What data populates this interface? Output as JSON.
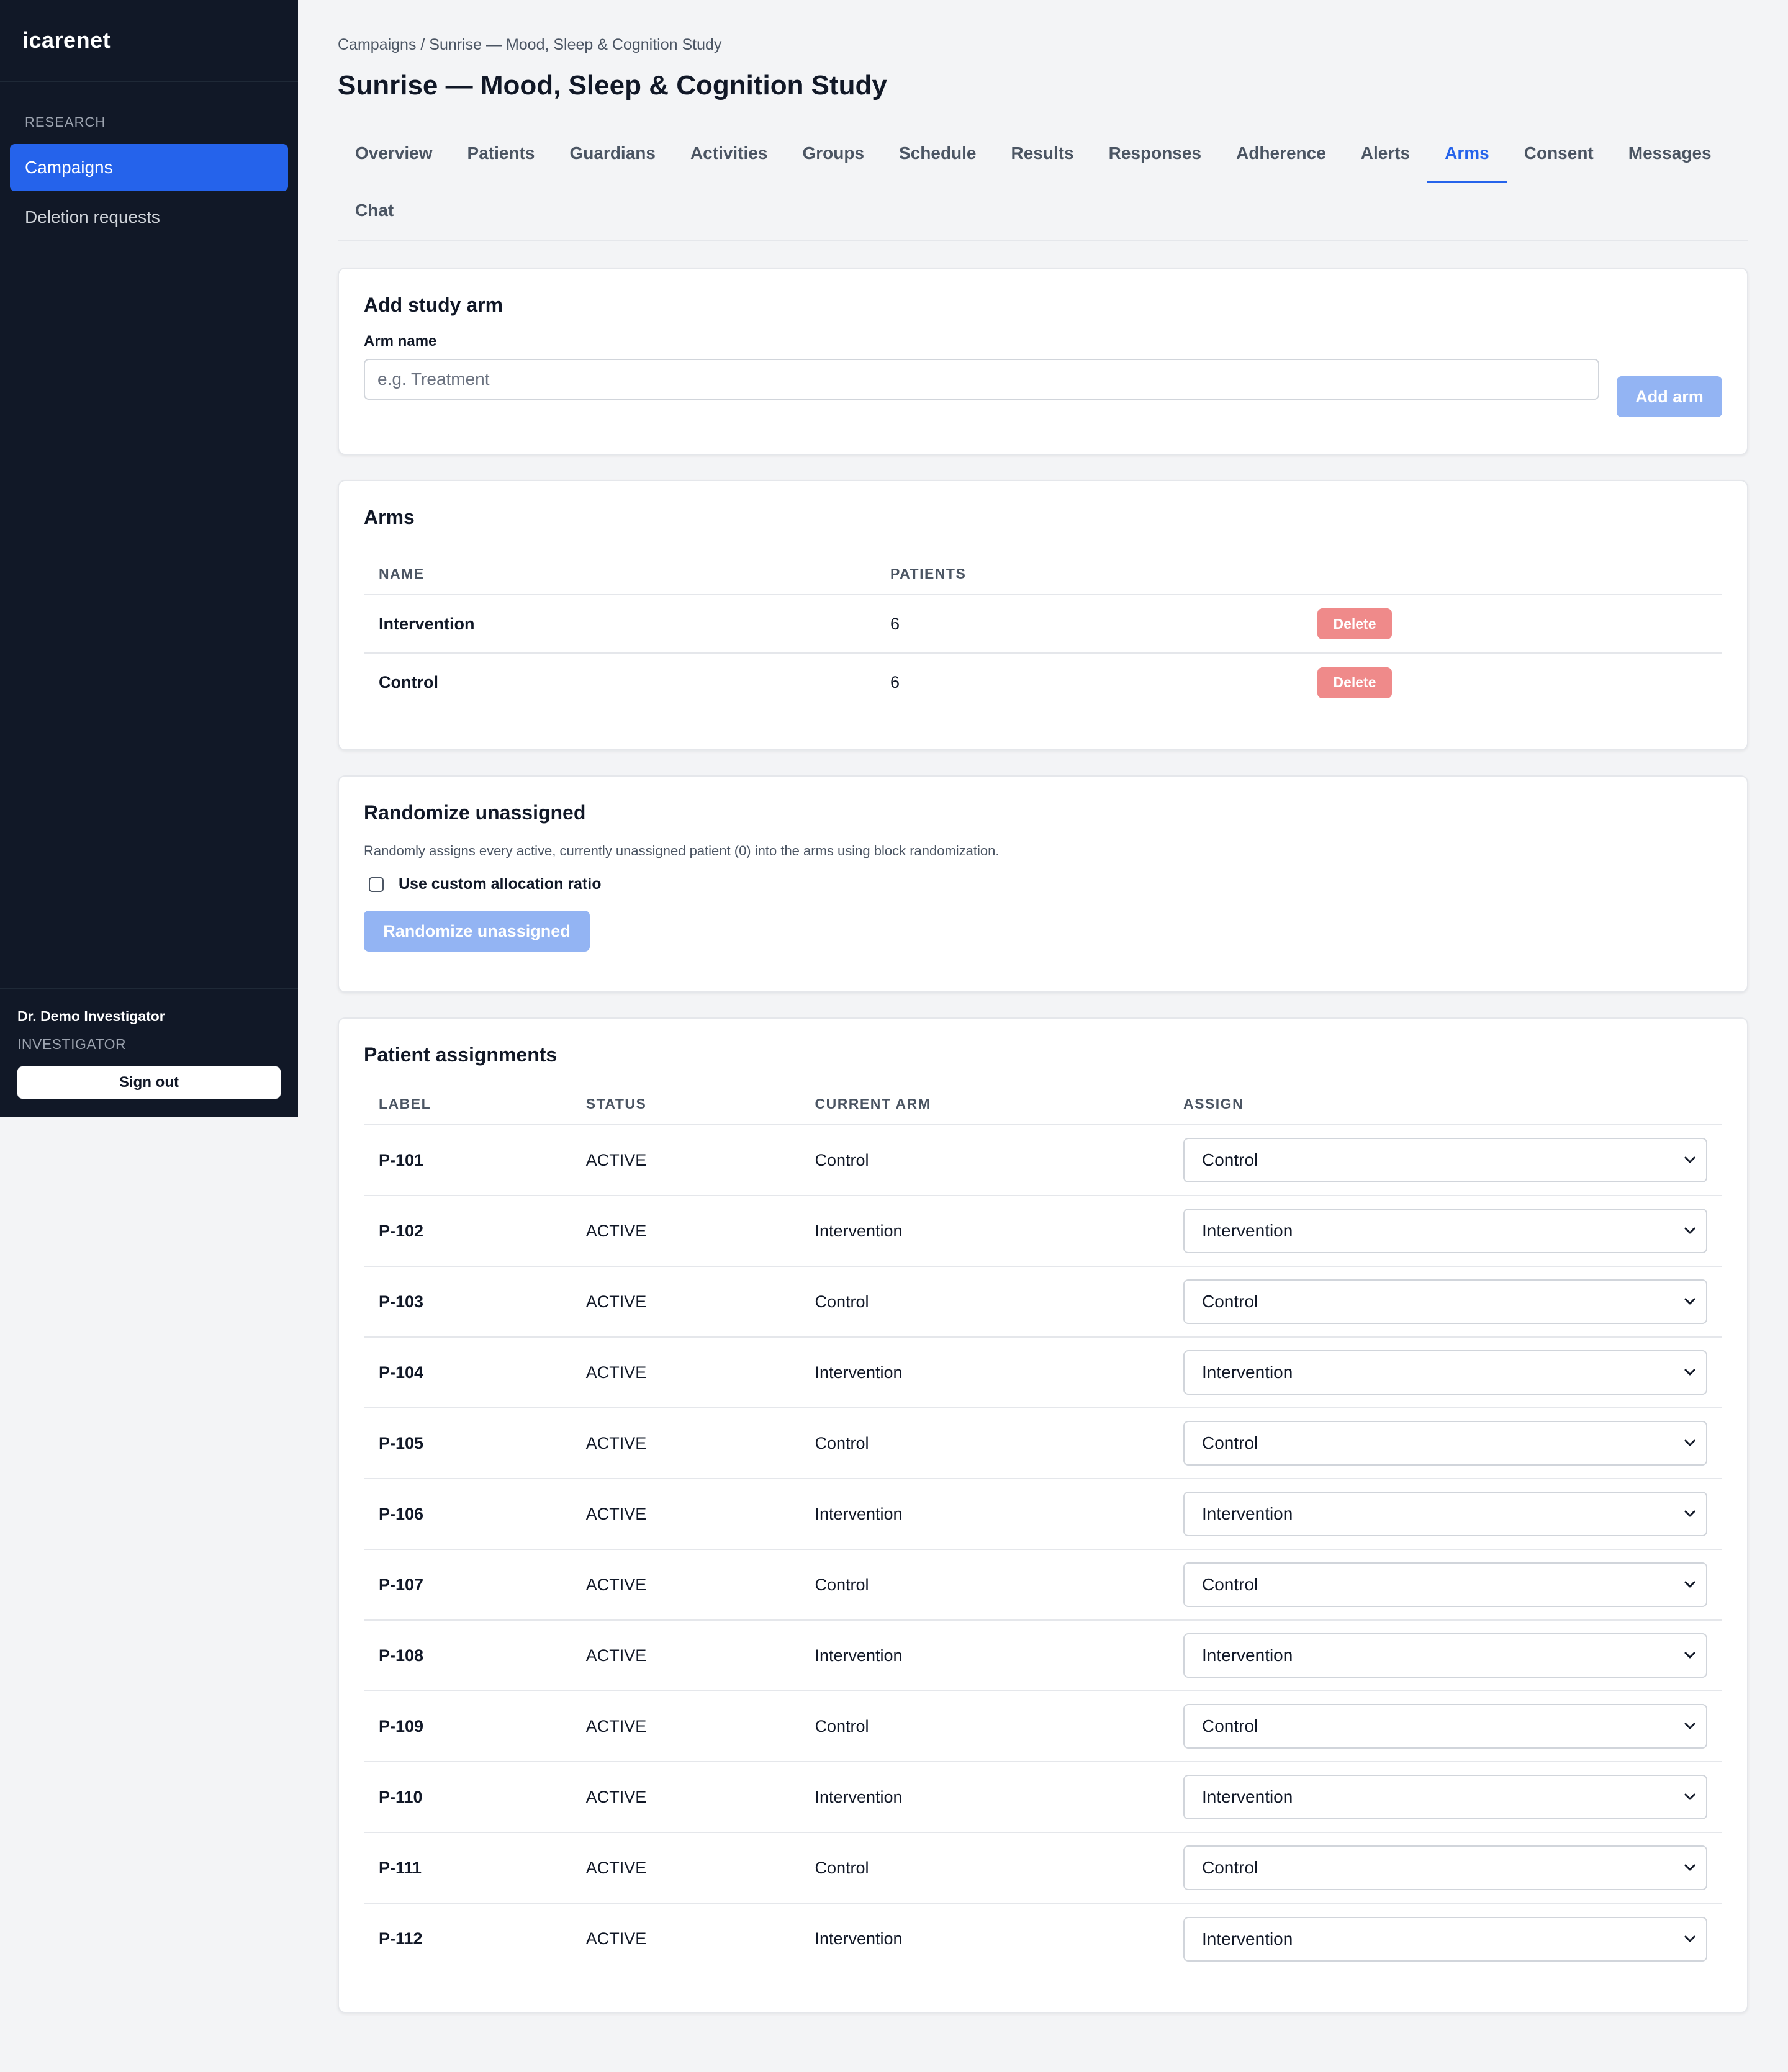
{
  "app": {
    "brand": "icarenet"
  },
  "sidebar": {
    "section": "RESEARCH",
    "items": [
      {
        "label": "Campaigns",
        "active": true
      },
      {
        "label": "Deletion requests",
        "active": false
      }
    ],
    "user": {
      "name": "Dr. Demo Investigator",
      "role": "INVESTIGATOR",
      "signout": "Sign out"
    }
  },
  "header": {
    "breadcrumb": "Campaigns / Sunrise — Mood, Sleep & Cognition Study",
    "title": "Sunrise — Mood, Sleep & Cognition Study"
  },
  "tabs": [
    {
      "label": "Overview"
    },
    {
      "label": "Patients"
    },
    {
      "label": "Guardians"
    },
    {
      "label": "Activities"
    },
    {
      "label": "Groups"
    },
    {
      "label": "Schedule"
    },
    {
      "label": "Results"
    },
    {
      "label": "Responses"
    },
    {
      "label": "Adherence"
    },
    {
      "label": "Alerts"
    },
    {
      "label": "Arms",
      "active": true
    },
    {
      "label": "Consent"
    },
    {
      "label": "Messages"
    },
    {
      "label": "Chat"
    }
  ],
  "add_arm": {
    "title": "Add study arm",
    "field_label": "Arm name",
    "value": "",
    "placeholder": "e.g. Treatment",
    "button": "Add arm"
  },
  "arms": {
    "title": "Arms",
    "columns": [
      "NAME",
      "PATIENTS"
    ],
    "rows": [
      {
        "name": "Intervention",
        "patients": "6",
        "action": "Delete"
      },
      {
        "name": "Control",
        "patients": "6",
        "action": "Delete"
      }
    ]
  },
  "randomize": {
    "title": "Randomize unassigned",
    "description": "Randomly assigns every active, currently unassigned patient (0) into the arms using block randomization.",
    "checkbox_label": "Use custom allocation ratio",
    "checked": false,
    "button": "Randomize unassigned"
  },
  "assignments": {
    "title": "Patient assignments",
    "columns": [
      "LABEL",
      "STATUS",
      "CURRENT ARM",
      "ASSIGN"
    ],
    "rows": [
      {
        "label": "P-101",
        "status": "ACTIVE",
        "current_arm": "Control",
        "assign": "Control"
      },
      {
        "label": "P-102",
        "status": "ACTIVE",
        "current_arm": "Intervention",
        "assign": "Intervention"
      },
      {
        "label": "P-103",
        "status": "ACTIVE",
        "current_arm": "Control",
        "assign": "Control"
      },
      {
        "label": "P-104",
        "status": "ACTIVE",
        "current_arm": "Intervention",
        "assign": "Intervention"
      },
      {
        "label": "P-105",
        "status": "ACTIVE",
        "current_arm": "Control",
        "assign": "Control"
      },
      {
        "label": "P-106",
        "status": "ACTIVE",
        "current_arm": "Intervention",
        "assign": "Intervention"
      },
      {
        "label": "P-107",
        "status": "ACTIVE",
        "current_arm": "Control",
        "assign": "Control"
      },
      {
        "label": "P-108",
        "status": "ACTIVE",
        "current_arm": "Intervention",
        "assign": "Intervention"
      },
      {
        "label": "P-109",
        "status": "ACTIVE",
        "current_arm": "Control",
        "assign": "Control"
      },
      {
        "label": "P-110",
        "status": "ACTIVE",
        "current_arm": "Intervention",
        "assign": "Intervention"
      },
      {
        "label": "P-111",
        "status": "ACTIVE",
        "current_arm": "Control",
        "assign": "Control"
      },
      {
        "label": "P-112",
        "status": "ACTIVE",
        "current_arm": "Intervention",
        "assign": "Intervention"
      }
    ]
  },
  "colors": {
    "sidebar_bg": "#111827",
    "accent": "#2563eb",
    "button_muted": "#93b4f3",
    "danger_muted": "#ef8a8a",
    "page_bg": "#f3f4f6"
  },
  "icons": {
    "select_chevron": "chevron-down-icon"
  }
}
